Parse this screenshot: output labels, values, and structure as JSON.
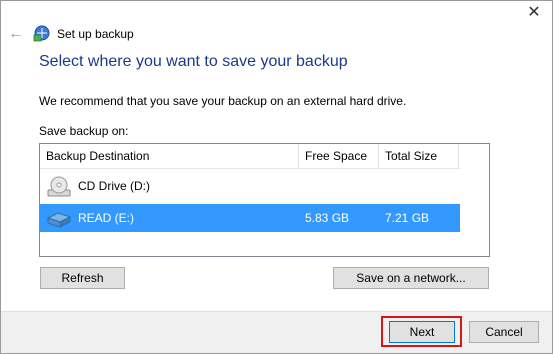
{
  "window": {
    "title": "Set up backup",
    "close_glyph": "✕",
    "back_glyph": "←"
  },
  "heading": "Select where you want to save your backup",
  "recommendation": "We recommend that you save your backup on an external hard drive.",
  "save_on_label": "Save backup on:",
  "columns": [
    "Backup Destination",
    "Free Space",
    "Total Size"
  ],
  "destinations": [
    {
      "name": "CD Drive (D:)",
      "free": "",
      "total": "",
      "icon": "cd-drive-icon",
      "selected": false
    },
    {
      "name": "READ (E:)",
      "free": "5.83 GB",
      "total": "7.21 GB",
      "icon": "usb-drive-icon",
      "selected": true
    }
  ],
  "buttons": {
    "refresh": "Refresh",
    "save_network": "Save on a network...",
    "next": "Next",
    "cancel": "Cancel"
  },
  "colors": {
    "heading": "#1c3a8c",
    "selection": "#3399ff",
    "highlight_box": "#d9141b"
  }
}
